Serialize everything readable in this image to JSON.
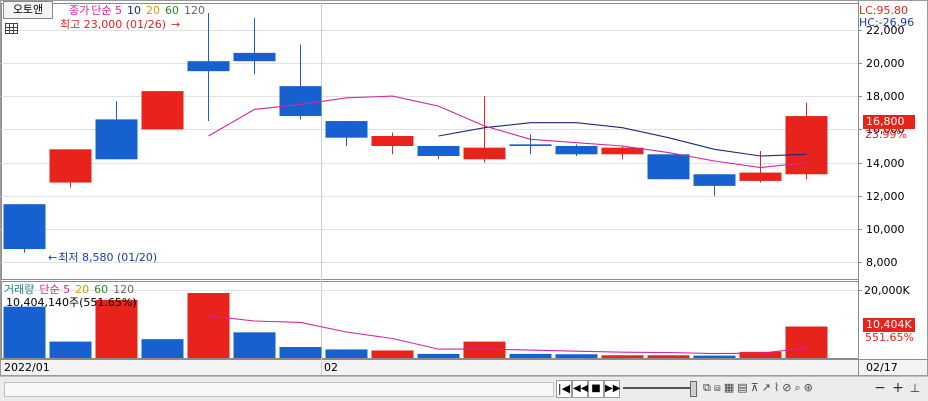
{
  "toolbar": {
    "auto_label": "오토앤"
  },
  "price_legend": {
    "main": "종가",
    "ma_label": "단순 5",
    "periods": [
      "10",
      "20",
      "60",
      "120"
    ],
    "high_note": "최고 23,000 (01/26)",
    "low_note": "최저 8,580 (01/20)"
  },
  "volume_legend": {
    "main": "거래량",
    "ma_label": "단순 5",
    "periods": [
      "20",
      "60",
      "120"
    ],
    "current": "10,404,140주(551.65%)"
  },
  "right_info": {
    "lc": "LC:95.80",
    "hc": "HC:-26.96"
  },
  "price_axis": {
    "ticks": [
      "22,000",
      "20,000",
      "18,000",
      "16,000",
      "14,000",
      "12,000",
      "10,000",
      "8,000"
    ],
    "current_value": "16,800",
    "current_pct": "23.99%"
  },
  "volume_axis": {
    "ticks": [
      "20,000K"
    ],
    "current_value": "10,404K",
    "current_pct": "551.65%"
  },
  "date_axis": {
    "labels": [
      "2022/01",
      "02"
    ],
    "right_label": "02/17"
  },
  "colors": {
    "up": "#e8231c",
    "down": "#1660d0",
    "ma_short": "#d3269f",
    "ma_long": "#1a2a7a",
    "accent_blue": "#1a3aa8"
  },
  "chart_data": [
    {
      "type": "candlestick",
      "ylim": [
        7000,
        23600
      ],
      "candles": [
        {
          "open": 11500,
          "close": 8800,
          "high": 11500,
          "low": 8580
        },
        {
          "open": 12800,
          "close": 14800,
          "high": 14800,
          "low": 12500
        },
        {
          "open": 16600,
          "close": 14200,
          "high": 17700,
          "low": 14200
        },
        {
          "open": 16000,
          "close": 18300,
          "high": 18300,
          "low": 16000
        },
        {
          "open": 20100,
          "close": 19500,
          "high": 23000,
          "low": 16500
        },
        {
          "open": 20600,
          "close": 20100,
          "high": 22700,
          "low": 19300
        },
        {
          "open": 18600,
          "close": 16800,
          "high": 21100,
          "low": 16600
        },
        {
          "open": 16500,
          "close": 15500,
          "high": 16500,
          "low": 15000
        },
        {
          "open": 15000,
          "close": 15600,
          "high": 15800,
          "low": 14500
        },
        {
          "open": 15000,
          "close": 14400,
          "high": 15000,
          "low": 14200
        },
        {
          "open": 14200,
          "close": 14900,
          "high": 18000,
          "low": 14000
        },
        {
          "open": 15100,
          "close": 15000,
          "high": 15700,
          "low": 14500
        },
        {
          "open": 15000,
          "close": 14500,
          "high": 15100,
          "low": 14400
        },
        {
          "open": 14500,
          "close": 14900,
          "high": 15000,
          "low": 14200
        },
        {
          "open": 14500,
          "close": 13000,
          "high": 14500,
          "low": 13000
        },
        {
          "open": 13300,
          "close": 12600,
          "high": 13300,
          "low": 12000
        },
        {
          "open": 12900,
          "close": 13400,
          "high": 14700,
          "low": 12800
        },
        {
          "open": 13300,
          "close": 16800,
          "high": 17600,
          "low": 13000
        }
      ],
      "ma5": [
        null,
        null,
        null,
        null,
        15600,
        17200,
        17500,
        17900,
        18000,
        17400,
        16200,
        15400,
        15200,
        15000,
        14600,
        14100,
        13700,
        14000
      ],
      "ma_long": [
        null,
        null,
        null,
        null,
        null,
        null,
        null,
        null,
        null,
        15600,
        16100,
        16400,
        16400,
        16100,
        15500,
        14800,
        14400,
        14500
      ]
    },
    {
      "type": "bar",
      "ylim": [
        0,
        22500
      ],
      "values": [
        15000,
        4800,
        17000,
        5500,
        19000,
        7500,
        3200,
        2500,
        2200,
        1200,
        4800,
        1200,
        1100,
        800,
        800,
        700,
        1800,
        9200
      ],
      "directions": [
        "down",
        "down",
        "up",
        "down",
        "up",
        "down",
        "down",
        "down",
        "up",
        "down",
        "up",
        "down",
        "down",
        "up",
        "up",
        "down",
        "up",
        "up"
      ],
      "ma5": [
        null,
        null,
        null,
        null,
        12300,
        10800,
        10400,
        7600,
        5700,
        2600,
        2600,
        2300,
        2000,
        1700,
        1600,
        1300,
        1400,
        2900
      ]
    }
  ]
}
